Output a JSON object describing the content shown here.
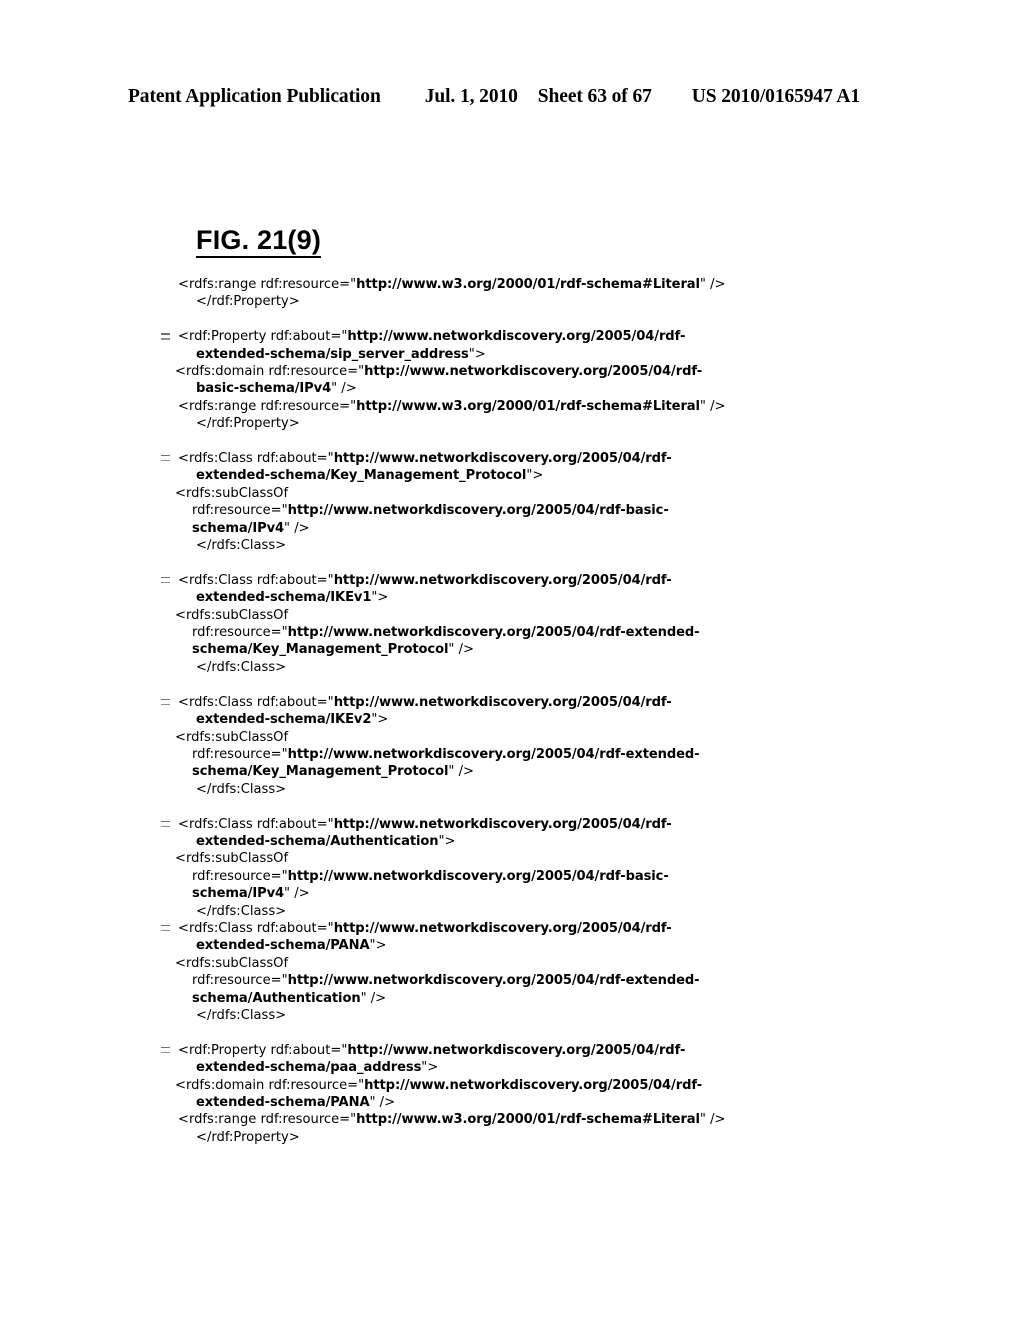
{
  "header": {
    "publication": "Patent Application Publication",
    "date": "Jul. 1, 2010",
    "sheet": "Sheet 63 of 67",
    "patent_number": "US 2010/0165947 A1"
  },
  "figure": {
    "label": "FIG. 21(9)"
  },
  "listing": {
    "marker_glyph": "–",
    "lines": [
      {
        "indent": "i0",
        "marker": false,
        "spacer": false,
        "segments": [
          {
            "t": "<rdfs:range rdf:resource=\"",
            "b": false
          },
          {
            "t": "http://www.w3.org/2000/01/rdf-schema#Literal",
            "b": true
          },
          {
            "t": "\" />",
            "b": false
          }
        ]
      },
      {
        "indent": "i1",
        "marker": false,
        "spacer": false,
        "segments": [
          {
            "t": "</rdf:Property>",
            "b": false
          }
        ]
      },
      {
        "indent": "i0",
        "marker": true,
        "spacer": true,
        "segments": [
          {
            "t": "<rdf:Property rdf:about=\"",
            "b": false
          },
          {
            "t": "http://www.networkdiscovery.org/2005/04/rdf-",
            "b": true
          }
        ]
      },
      {
        "indent": "i1",
        "marker": false,
        "spacer": false,
        "segments": [
          {
            "t": "extended-schema/sip_server_address",
            "b": true
          },
          {
            "t": "\">",
            "b": false
          }
        ]
      },
      {
        "indent": "i2",
        "marker": false,
        "spacer": false,
        "segments": [
          {
            "t": "<rdfs:domain rdf:resource=\"",
            "b": false
          },
          {
            "t": "http://www.networkdiscovery.org/2005/04/rdf-",
            "b": true
          }
        ]
      },
      {
        "indent": "i1",
        "marker": false,
        "spacer": false,
        "segments": [
          {
            "t": "basic-schema/IPv4",
            "b": true
          },
          {
            "t": "\" />",
            "b": false
          }
        ]
      },
      {
        "indent": "i0",
        "marker": false,
        "spacer": false,
        "segments": [
          {
            "t": "<rdfs:range rdf:resource=\"",
            "b": false
          },
          {
            "t": "http://www.w3.org/2000/01/rdf-schema#Literal",
            "b": true
          },
          {
            "t": "\" />",
            "b": false
          }
        ]
      },
      {
        "indent": "i1",
        "marker": false,
        "spacer": false,
        "segments": [
          {
            "t": "</rdf:Property>",
            "b": false
          }
        ]
      },
      {
        "indent": "i0",
        "marker": true,
        "spacer": true,
        "segments": [
          {
            "t": "<rdfs:Class rdf:about=\"",
            "b": false
          },
          {
            "t": "http://www.networkdiscovery.org/2005/04/rdf-",
            "b": true
          }
        ]
      },
      {
        "indent": "i1",
        "marker": false,
        "spacer": false,
        "segments": [
          {
            "t": "extended-schema/Key_Management_Protocol",
            "b": true
          },
          {
            "t": "\">",
            "b": false
          }
        ]
      },
      {
        "indent": "i2",
        "marker": false,
        "spacer": false,
        "segments": [
          {
            "t": "<rdfs:subClassOf",
            "b": false
          }
        ]
      },
      {
        "indent": "i3",
        "marker": false,
        "spacer": false,
        "segments": [
          {
            "t": "rdf:resource=\"",
            "b": false
          },
          {
            "t": "http://www.networkdiscovery.org/2005/04/rdf-basic-",
            "b": true
          }
        ]
      },
      {
        "indent": "i3",
        "marker": false,
        "spacer": false,
        "segments": [
          {
            "t": "schema/IPv4",
            "b": true
          },
          {
            "t": "\" />",
            "b": false
          }
        ]
      },
      {
        "indent": "i1",
        "marker": false,
        "spacer": false,
        "segments": [
          {
            "t": "</rdfs:Class>",
            "b": false
          }
        ]
      },
      {
        "indent": "i0",
        "marker": true,
        "spacer": true,
        "segments": [
          {
            "t": "<rdfs:Class rdf:about=\"",
            "b": false
          },
          {
            "t": "http://www.networkdiscovery.org/2005/04/rdf-",
            "b": true
          }
        ]
      },
      {
        "indent": "i1",
        "marker": false,
        "spacer": false,
        "segments": [
          {
            "t": "extended-schema/IKEv1",
            "b": true
          },
          {
            "t": "\">",
            "b": false
          }
        ]
      },
      {
        "indent": "i2",
        "marker": false,
        "spacer": false,
        "segments": [
          {
            "t": "<rdfs:subClassOf",
            "b": false
          }
        ]
      },
      {
        "indent": "i3",
        "marker": false,
        "spacer": false,
        "segments": [
          {
            "t": "rdf:resource=\"",
            "b": false
          },
          {
            "t": "http://www.networkdiscovery.org/2005/04/rdf-extended-",
            "b": true
          }
        ]
      },
      {
        "indent": "i3",
        "marker": false,
        "spacer": false,
        "segments": [
          {
            "t": "schema/Key_Management_Protocol",
            "b": true
          },
          {
            "t": "\" />",
            "b": false
          }
        ]
      },
      {
        "indent": "i1",
        "marker": false,
        "spacer": false,
        "segments": [
          {
            "t": "</rdfs:Class>",
            "b": false
          }
        ]
      },
      {
        "indent": "i0",
        "marker": true,
        "spacer": true,
        "segments": [
          {
            "t": "<rdfs:Class rdf:about=\"",
            "b": false
          },
          {
            "t": "http://www.networkdiscovery.org/2005/04/rdf-",
            "b": true
          }
        ]
      },
      {
        "indent": "i1",
        "marker": false,
        "spacer": false,
        "segments": [
          {
            "t": "extended-schema/IKEv2",
            "b": true
          },
          {
            "t": "\">",
            "b": false
          }
        ]
      },
      {
        "indent": "i2",
        "marker": false,
        "spacer": false,
        "segments": [
          {
            "t": "<rdfs:subClassOf",
            "b": false
          }
        ]
      },
      {
        "indent": "i3",
        "marker": false,
        "spacer": false,
        "segments": [
          {
            "t": "rdf:resource=\"",
            "b": false
          },
          {
            "t": "http://www.networkdiscovery.org/2005/04/rdf-extended-",
            "b": true
          }
        ]
      },
      {
        "indent": "i3",
        "marker": false,
        "spacer": false,
        "segments": [
          {
            "t": "schema/Key_Management_Protocol",
            "b": true
          },
          {
            "t": "\" />",
            "b": false
          }
        ]
      },
      {
        "indent": "i1",
        "marker": false,
        "spacer": false,
        "segments": [
          {
            "t": "</rdfs:Class>",
            "b": false
          }
        ]
      },
      {
        "indent": "i0",
        "marker": true,
        "spacer": true,
        "segments": [
          {
            "t": "<rdfs:Class rdf:about=\"",
            "b": false
          },
          {
            "t": "http://www.networkdiscovery.org/2005/04/rdf-",
            "b": true
          }
        ]
      },
      {
        "indent": "i1",
        "marker": false,
        "spacer": false,
        "segments": [
          {
            "t": "extended-schema/Authentication",
            "b": true
          },
          {
            "t": "\">",
            "b": false
          }
        ]
      },
      {
        "indent": "i2",
        "marker": false,
        "spacer": false,
        "segments": [
          {
            "t": "<rdfs:subClassOf",
            "b": false
          }
        ]
      },
      {
        "indent": "i3",
        "marker": false,
        "spacer": false,
        "segments": [
          {
            "t": "rdf:resource=\"",
            "b": false
          },
          {
            "t": "http://www.networkdiscovery.org/2005/04/rdf-basic-",
            "b": true
          }
        ]
      },
      {
        "indent": "i3",
        "marker": false,
        "spacer": false,
        "segments": [
          {
            "t": "schema/IPv4",
            "b": true
          },
          {
            "t": "\" />",
            "b": false
          }
        ]
      },
      {
        "indent": "i1",
        "marker": false,
        "spacer": false,
        "segments": [
          {
            "t": "</rdfs:Class>",
            "b": false
          }
        ]
      },
      {
        "indent": "i0",
        "marker": true,
        "spacer": false,
        "segments": [
          {
            "t": "<rdfs:Class rdf:about=\"",
            "b": false
          },
          {
            "t": "http://www.networkdiscovery.org/2005/04/rdf-",
            "b": true
          }
        ]
      },
      {
        "indent": "i1",
        "marker": false,
        "spacer": false,
        "segments": [
          {
            "t": "extended-schema/PANA",
            "b": true
          },
          {
            "t": "\">",
            "b": false
          }
        ]
      },
      {
        "indent": "i2",
        "marker": false,
        "spacer": false,
        "segments": [
          {
            "t": "<rdfs:subClassOf",
            "b": false
          }
        ]
      },
      {
        "indent": "i3",
        "marker": false,
        "spacer": false,
        "segments": [
          {
            "t": "rdf:resource=\"",
            "b": false
          },
          {
            "t": "http://www.networkdiscovery.org/2005/04/rdf-extended-",
            "b": true
          }
        ]
      },
      {
        "indent": "i3",
        "marker": false,
        "spacer": false,
        "segments": [
          {
            "t": "schema/Authentication",
            "b": true
          },
          {
            "t": "\" />",
            "b": false
          }
        ]
      },
      {
        "indent": "i1",
        "marker": false,
        "spacer": false,
        "segments": [
          {
            "t": "</rdfs:Class>",
            "b": false
          }
        ]
      },
      {
        "indent": "i0",
        "marker": true,
        "spacer": true,
        "segments": [
          {
            "t": "<rdf:Property rdf:about=\"",
            "b": false
          },
          {
            "t": "http://www.networkdiscovery.org/2005/04/rdf-",
            "b": true
          }
        ]
      },
      {
        "indent": "i1",
        "marker": false,
        "spacer": false,
        "segments": [
          {
            "t": "extended-schema/paa_address",
            "b": true
          },
          {
            "t": "\">",
            "b": false
          }
        ]
      },
      {
        "indent": "i2",
        "marker": false,
        "spacer": false,
        "segments": [
          {
            "t": "<rdfs:domain rdf:resource=\"",
            "b": false
          },
          {
            "t": "http://www.networkdiscovery.org/2005/04/rdf-",
            "b": true
          }
        ]
      },
      {
        "indent": "i1",
        "marker": false,
        "spacer": false,
        "segments": [
          {
            "t": "extended-schema/PANA",
            "b": true
          },
          {
            "t": "\" />",
            "b": false
          }
        ]
      },
      {
        "indent": "i0",
        "marker": false,
        "spacer": false,
        "segments": [
          {
            "t": "<rdfs:range rdf:resource=\"",
            "b": false
          },
          {
            "t": "http://www.w3.org/2000/01/rdf-schema#Literal",
            "b": true
          },
          {
            "t": "\" />",
            "b": false
          }
        ]
      },
      {
        "indent": "i1",
        "marker": false,
        "spacer": false,
        "segments": [
          {
            "t": "</rdf:Property>",
            "b": false
          }
        ]
      }
    ]
  }
}
